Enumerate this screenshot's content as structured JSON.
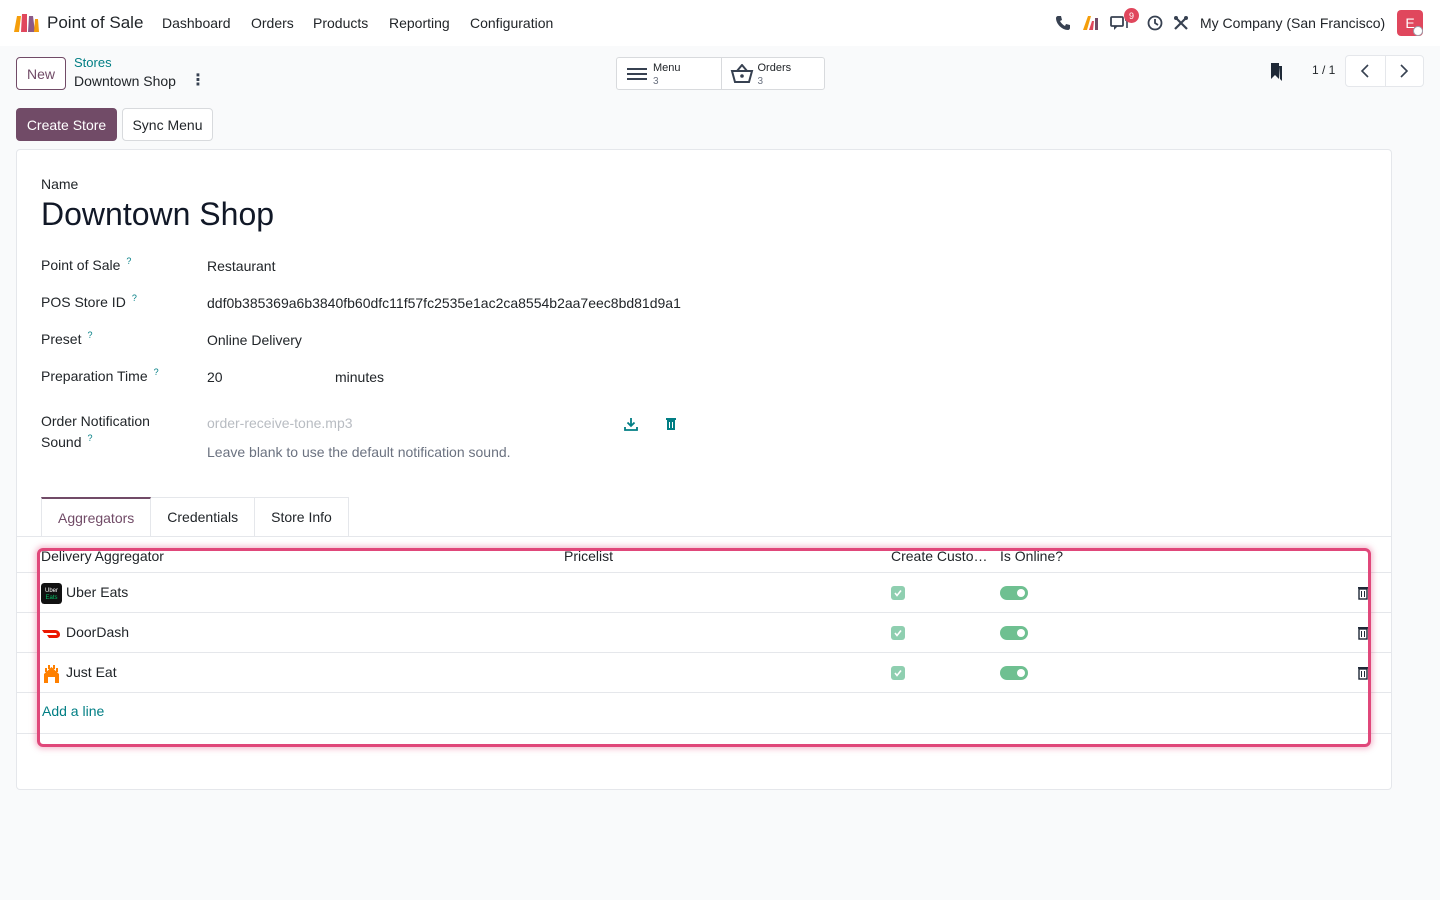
{
  "navbar": {
    "app_name": "Point of Sale",
    "menu": [
      "Dashboard",
      "Orders",
      "Products",
      "Reporting",
      "Configuration"
    ],
    "notification_count": "9",
    "company": "My Company (San Francisco)",
    "avatar_letter": "E"
  },
  "control_panel": {
    "new_label": "New",
    "breadcrumb_parent": "Stores",
    "breadcrumb_current": "Downtown Shop",
    "smart_buttons": [
      {
        "label": "Menu",
        "value": "3",
        "icon": "hamburger-icon"
      },
      {
        "label": "Orders",
        "value": "3",
        "icon": "basket-icon"
      }
    ],
    "pager_value": "1 / 1",
    "create_store_label": "Create Store",
    "sync_menu_label": "Sync Menu"
  },
  "form": {
    "name_label": "Name",
    "name_value": "Downtown Shop",
    "fields": {
      "pos_label": "Point of Sale",
      "pos_value": "Restaurant",
      "store_id_label": "POS Store ID",
      "store_id_value": "ddf0b385369a6b3840fb60dfc11f57fc2535e1ac2ca8554b2aa7eec8bd81d9a1",
      "preset_label": "Preset",
      "preset_value": "Online Delivery",
      "prep_time_label": "Preparation Time",
      "prep_time_value": "20",
      "prep_time_unit": "minutes",
      "sound_label_1": "Order Notification",
      "sound_label_2": "Sound",
      "sound_placeholder": "order-receive-tone.mp3",
      "sound_hint": "Leave blank to use the default notification sound."
    },
    "help_mark": "?"
  },
  "tabs": [
    "Aggregators",
    "Credentials",
    "Store Info"
  ],
  "list": {
    "headers": {
      "aggregator": "Delivery Aggregator",
      "pricelist": "Pricelist",
      "create_customer": "Create Custo…",
      "is_online": "Is Online?"
    },
    "rows": [
      {
        "name": "Uber Eats",
        "logo": "uber-eats-logo",
        "create_customer": true,
        "is_online": true
      },
      {
        "name": "DoorDash",
        "logo": "doordash-logo",
        "create_customer": true,
        "is_online": true
      },
      {
        "name": "Just Eat",
        "logo": "just-eat-logo",
        "create_customer": true,
        "is_online": true
      }
    ],
    "add_line_label": "Add a line"
  },
  "colors": {
    "brand": "#714b67",
    "link": "#017e84",
    "highlight": "#e0477a",
    "toggle_on": "#6fc091"
  }
}
